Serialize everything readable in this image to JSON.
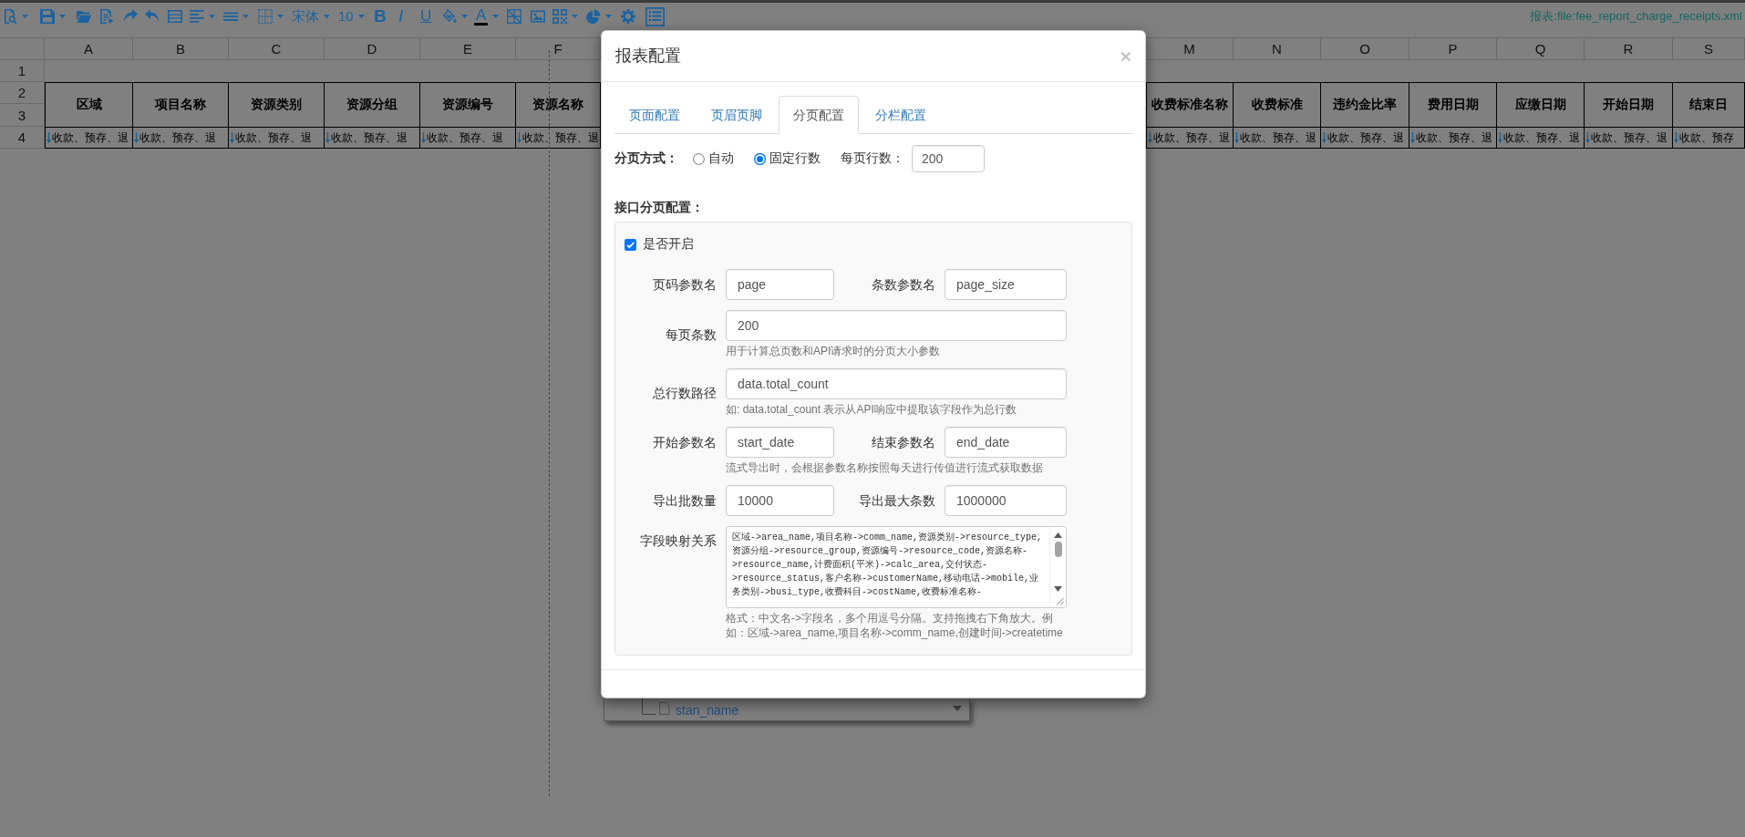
{
  "toolbar": {
    "font_name": "宋体",
    "font_size": "10",
    "bold": "B",
    "italic": "I",
    "underline": "U",
    "font_color": "A",
    "file_label": "报表:file:fee_report_charge_receipts.xml"
  },
  "sheet": {
    "row_numbers": [
      "1",
      "2",
      "3",
      "4"
    ],
    "columns": [
      {
        "letter": "A",
        "header": "区域",
        "cell": "收款、预存、退"
      },
      {
        "letter": "B",
        "header": "项目名称",
        "cell": "收款、预存、退"
      },
      {
        "letter": "C",
        "header": "资源类别",
        "cell": "收款、预存、退"
      },
      {
        "letter": "D",
        "header": "资源分组",
        "cell": "收款、预存、退"
      },
      {
        "letter": "E",
        "header": "资源编号",
        "cell": "收款、预存、退"
      },
      {
        "letter": "F",
        "header": "资源名称",
        "cell": "收款、预存、退"
      }
    ],
    "right_columns": [
      {
        "letter": "M",
        "header": "收费标准名称",
        "cell": "收款、预存、退"
      },
      {
        "letter": "N",
        "header": "收费标准",
        "cell": "收款、预存、退"
      },
      {
        "letter": "O",
        "header": "违约金比率",
        "cell": "收款、预存、退"
      },
      {
        "letter": "P",
        "header": "费用日期",
        "cell": "收款、预存、退"
      },
      {
        "letter": "Q",
        "header": "应缴日期",
        "cell": "收款、预存、退"
      },
      {
        "letter": "R",
        "header": "开始日期",
        "cell": "收款、预存、退"
      },
      {
        "letter": "S",
        "header": "结束日",
        "cell": "收款、预存"
      }
    ]
  },
  "field_panel": {
    "field": "stan_name"
  },
  "dialog": {
    "title": "报表配置",
    "close": "×",
    "tabs": [
      {
        "label": "页面配置",
        "selected": false
      },
      {
        "label": "页眉页脚",
        "selected": false
      },
      {
        "label": "分页配置",
        "selected": true
      },
      {
        "label": "分栏配置",
        "selected": false
      }
    ],
    "paging": {
      "label": "分页方式：",
      "options": [
        {
          "label": "自动",
          "selected": false
        },
        {
          "label": "固定行数",
          "selected": true
        }
      ],
      "rows_per_page_label": "每页行数：",
      "rows_per_page": "200"
    },
    "api": {
      "heading": "接口分页配置：",
      "enabled": {
        "label": "是否开启",
        "checked": true
      },
      "rows": [
        {
          "fields": [
            {
              "label": "页码参数名",
              "value": "page"
            },
            {
              "label": "条数参数名",
              "value": "page_size"
            }
          ]
        },
        {
          "fields": [
            {
              "label": "每页条数",
              "value": "200"
            }
          ],
          "help": "用于计算总页数和API请求时的分页大小参数"
        },
        {
          "fields": [
            {
              "label": "总行数路径",
              "value": "data.total_count"
            }
          ],
          "help": "如: data.total_count 表示从API响应中提取该字段作为总行数"
        },
        {
          "fields": [
            {
              "label": "开始参数名",
              "value": "start_date"
            },
            {
              "label": "结束参数名",
              "value": "end_date"
            }
          ],
          "help": "流式导出时，会根据参数名称按照每天进行传值进行流式获取数据"
        },
        {
          "fields": [
            {
              "label": "导出批数量",
              "value": "10000"
            },
            {
              "label": "导出最大条数",
              "value": "1000000"
            }
          ]
        }
      ],
      "mapping": {
        "label": "字段映射关系",
        "value": "区域->area_name,项目名称->comm_name,资源类别->resource_type,资源分组->resource_group,资源编号->resource_code,资源名称->resource_name,计费面积(平米)->calc_area,交付状态->resource_status,客户名称->customerName,移动电话->mobile,业务类别->busi_type,收费科目->costName,收费标准名称-",
        "help": "格式：中文名->字段名，多个用逗号分隔。支持拖拽右下角放大。例如：区域->area_name,项目名称->comm_name,创建时间->createtime"
      }
    }
  }
}
